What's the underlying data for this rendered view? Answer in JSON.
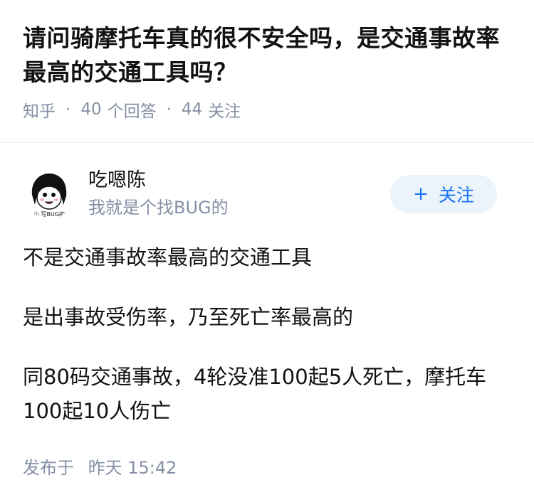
{
  "question": {
    "title": "请问骑摩托车真的很不安全吗，是交通事故率最高的交通工具吗？",
    "source": "知乎",
    "answers_count": "40",
    "answers_label": "个回答",
    "follows_count": "44",
    "follows_label": "关注"
  },
  "answer": {
    "author_name": "吃嗯陈",
    "author_bio": "我就是个找BUG的",
    "avatar_text": "小 写BUG的",
    "follow_label": "关注",
    "paragraphs": [
      "不是交通事故率最高的交通工具",
      "是出事故受伤率，乃至死亡率最高的",
      "同80码交通事故，4轮没准100起5人死亡，摩托车100起10人伤亡"
    ],
    "posted_label": "发布于",
    "posted_time": "昨天 15:42"
  },
  "colors": {
    "accent": "#1772f6",
    "follow_bg": "#ebf3fb",
    "meta_gray": "#8590a6"
  }
}
